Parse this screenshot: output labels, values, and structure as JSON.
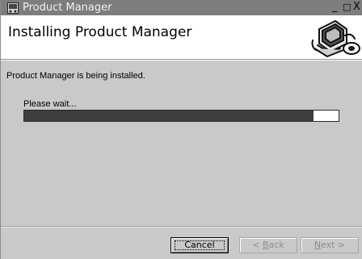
{
  "window": {
    "title": "Product Manager",
    "controls": {
      "minimize": "_",
      "maximize": "□",
      "close": "X"
    }
  },
  "header": {
    "title": "Installing Product Manager",
    "logo_icon": "computer-disc-icon"
  },
  "body": {
    "status": "Product Manager is being installed.",
    "wait_label": "Please wait...",
    "progress_fraction": 0.92
  },
  "buttons": {
    "cancel": "Cancel",
    "back_prefix": "< ",
    "back_access": "B",
    "back_rest": "ack",
    "next_access": "N",
    "next_rest": "ext >"
  },
  "colors": {
    "titlebar": "#7d7d7d",
    "progress_fill": "#3d3d3d",
    "background": "#c9c9c9"
  }
}
